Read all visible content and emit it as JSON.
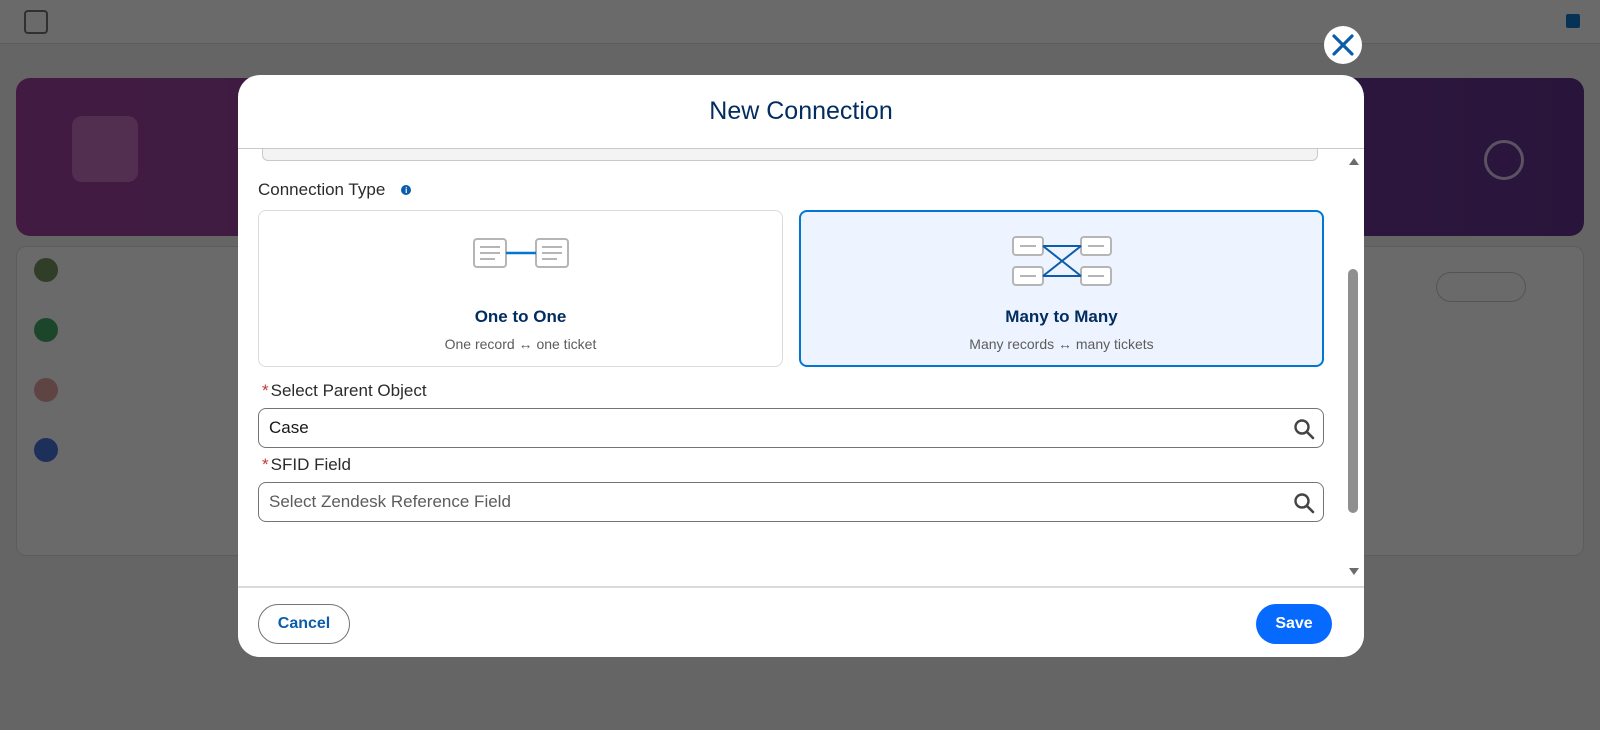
{
  "modal": {
    "title": "New Connection",
    "connection_type_label": "Connection Type",
    "cards": [
      {
        "title": "One to One",
        "description": "One record ↔ one ticket",
        "selected": false
      },
      {
        "title": "Many to Many",
        "description": "Many records ↔ many tickets",
        "selected": true
      }
    ],
    "parent_object": {
      "label": "Select Parent Object",
      "required_mark": "*",
      "value": "Case"
    },
    "sfid_field": {
      "label": "SFID Field",
      "required_mark": "*",
      "placeholder": "Select Zendesk Reference Field",
      "value": ""
    },
    "cancel_label": "Cancel",
    "save_label": "Save"
  },
  "colors": {
    "accent": "#0176d3",
    "title": "#032d60",
    "save_bg": "#066afe",
    "selected_card_bg": "#eef4ff",
    "required": "#c23934"
  },
  "icons": {
    "close": "close-icon",
    "info": "info-icon",
    "search": "search-icon",
    "one_to_one": "one-to-one-diagram-icon",
    "many_to_many": "many-to-many-diagram-icon"
  }
}
